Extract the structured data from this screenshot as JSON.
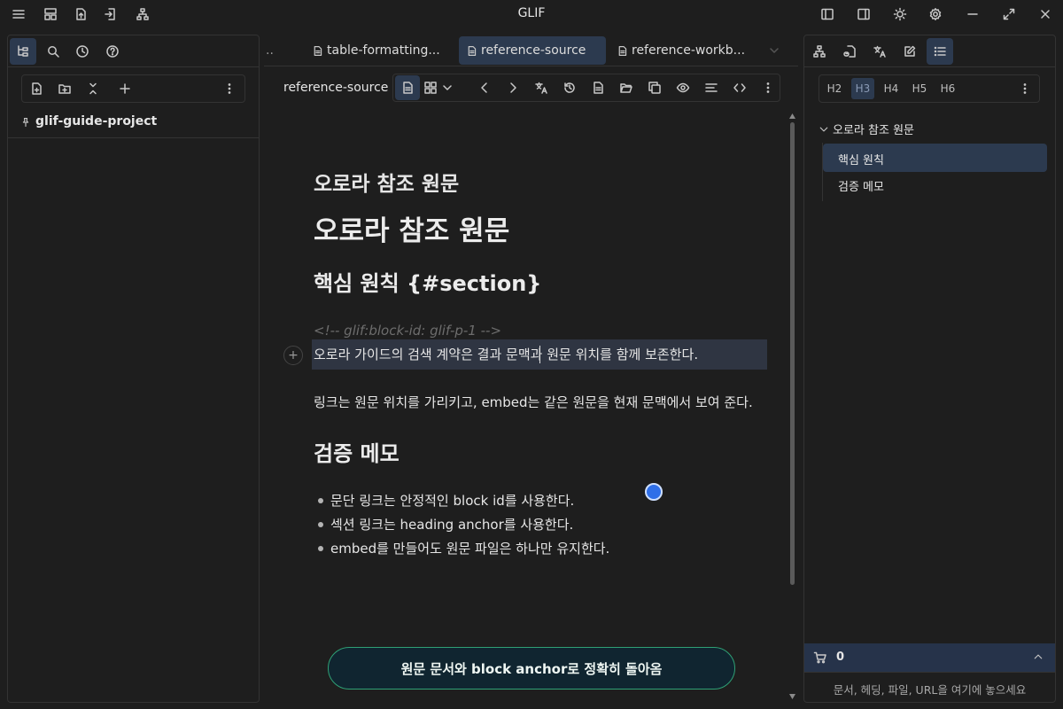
{
  "app": {
    "title": "GLIF"
  },
  "tabs": [
    {
      "label": "table-formatting..."
    },
    {
      "label": "reference-source"
    },
    {
      "label": "reference-workb..."
    }
  ],
  "left_panel": {
    "project_name": "glif-guide-project"
  },
  "view": {
    "title": "reference-source"
  },
  "document": {
    "title_small": "오로라 참조 원문",
    "h1": "오로라 참조 원문",
    "h2_section": "핵심 원칙 {#section}",
    "block_comment": "<!-- glif:block-id: glif-p-1 -->",
    "paragraph_1": "오로라 가이드의 검색 계약은 결과 문맥과 원문 위치를 함께 보존한다.",
    "paragraph_2": "링크는 원문 위치를 가리키고, embed는 같은 원문을 현재 문맥에서 보여 준다.",
    "h2_memo": "검증 메모",
    "list": [
      "문단 링크는 안정적인 block id를 사용한다.",
      "섹션 링크는 heading anchor를 사용한다.",
      "embed를 만들어도 원문 파일은 하나만 유지한다."
    ]
  },
  "return_button": {
    "label": "원문 문서와 block anchor로 정확히 돌아옴"
  },
  "outline": {
    "heading_levels": [
      "H2",
      "H3",
      "H4",
      "H5",
      "H6"
    ],
    "active_level": "H3",
    "root": "오로라 참조 원문",
    "items": [
      "핵심 원칙",
      "검증 메모"
    ]
  },
  "cart": {
    "count": "0",
    "drop_placeholder": "문서, 헤딩, 파일, URL을 여기에 놓으세요"
  },
  "colors": {
    "accent": "#2f6fe8",
    "active_bg": "#2c3a4f",
    "button_border": "#2fa075"
  }
}
